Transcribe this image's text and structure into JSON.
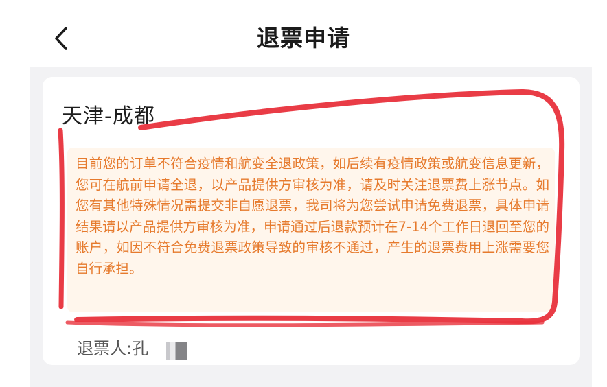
{
  "header": {
    "title": "退票申请",
    "back_icon": "chevron-left-icon"
  },
  "card": {
    "route": "天津-成都",
    "notice": "目前您的订单不符合疫情和航变全退政策，如后续有疫情政策或航变信息更新，您可在航前申请全退，以产品提供方审核为准，请及时关注退票费上涨节点。如您有其他特殊情况需提交非自愿退票，我司将为您尝试申请免费退票，具体申请结果请以产品提供方审核为准，申请通过后退款预计在7-14个工作日退回至您的账户，如因不符合免费退票政策导致的审核不通过，产生的退票费用上涨需要您自行承担。",
    "passenger": {
      "label": "退票人:",
      "name": "孔"
    }
  },
  "colors": {
    "notice_text": "#e67a2d",
    "notice_background": "#fff6ec",
    "page_background": "#f2f2f4",
    "marker": "#e8323c"
  }
}
